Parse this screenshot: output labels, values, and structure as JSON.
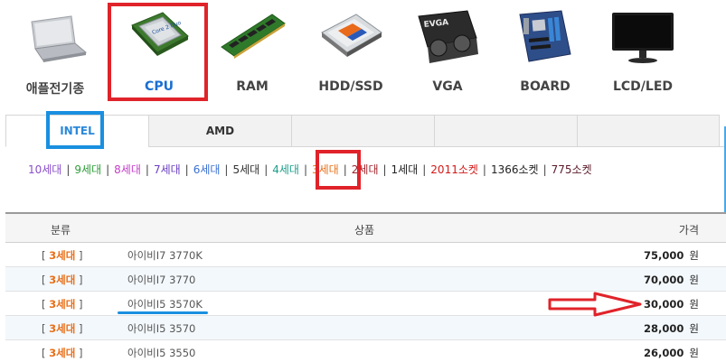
{
  "categories": [
    {
      "label": "애플전기종",
      "icon": "laptop-icon"
    },
    {
      "label": "CPU",
      "icon": "cpu-chip-icon"
    },
    {
      "label": "RAM",
      "icon": "ram-module-icon"
    },
    {
      "label": "HDD/SSD",
      "icon": "ssd-icon"
    },
    {
      "label": "VGA",
      "icon": "graphics-card-icon"
    },
    {
      "label": "BOARD",
      "icon": "motherboard-icon"
    },
    {
      "label": "LCD/LED",
      "icon": "monitor-icon"
    }
  ],
  "selected_category": "CPU",
  "tabs": [
    {
      "label": "INTEL",
      "active": true
    },
    {
      "label": "AMD",
      "active": false
    },
    {
      "label": "",
      "active": false
    },
    {
      "label": "",
      "active": false
    },
    {
      "label": "",
      "active": false
    }
  ],
  "generations": [
    {
      "label": "10세대",
      "color": "#8a4fc9"
    },
    {
      "label": "9세대",
      "color": "#2e9e3a"
    },
    {
      "label": "8세대",
      "color": "#c43ec9"
    },
    {
      "label": "7세대",
      "color": "#6a3fc0"
    },
    {
      "label": "6세대",
      "color": "#3a6fd1"
    },
    {
      "label": "5세대",
      "color": "#333333"
    },
    {
      "label": "4세대",
      "color": "#1f9e8a"
    },
    {
      "label": "3세대",
      "color": "#e8701a"
    },
    {
      "label": "2세대",
      "color": "#a0222a"
    },
    {
      "label": "1세대",
      "color": "#222222"
    },
    {
      "label": "2011소켓",
      "color": "#d11a1a"
    },
    {
      "label": "1366소켓",
      "color": "#222222"
    },
    {
      "label": "775소켓",
      "color": "#5a1a2a"
    }
  ],
  "table": {
    "headers": {
      "category": "분류",
      "product": "상품",
      "price": "가격"
    },
    "rows": [
      {
        "bracket_open": "[ ",
        "category": "3세대",
        "bracket_close": " ]",
        "name": "아이비I7 3770K",
        "price": "75,000",
        "unit": "원"
      },
      {
        "bracket_open": "[ ",
        "category": "3세대",
        "bracket_close": " ]",
        "name": "아이비I7 3770",
        "price": "70,000",
        "unit": "원"
      },
      {
        "bracket_open": "[ ",
        "category": "3세대",
        "bracket_close": " ]",
        "name": "아이비I5 3570K",
        "price": "30,000",
        "unit": "원"
      },
      {
        "bracket_open": "[ ",
        "category": "3세대",
        "bracket_close": " ]",
        "name": "아이비I5 3570",
        "price": "28,000",
        "unit": "원"
      },
      {
        "bracket_open": "[ ",
        "category": "3세대",
        "bracket_close": " ]",
        "name": "아이비I5 3550",
        "price": "26,000",
        "unit": "원"
      }
    ]
  },
  "colors": {
    "highlight_red": "#e0232a",
    "highlight_blue": "#1a8fe0",
    "active_blue": "#1a6fd1",
    "generation_accent": "#e8701a"
  }
}
